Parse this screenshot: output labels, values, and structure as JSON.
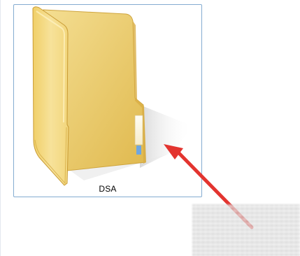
{
  "folder": {
    "name": "DSA",
    "icon": "folder-icon"
  },
  "annotation": {
    "icon": "red-arrow-icon",
    "color": "#e3342f"
  },
  "colors": {
    "selection_border": "#84acd1",
    "folder_front": "#f3d77a",
    "folder_back": "#e8c25c"
  }
}
